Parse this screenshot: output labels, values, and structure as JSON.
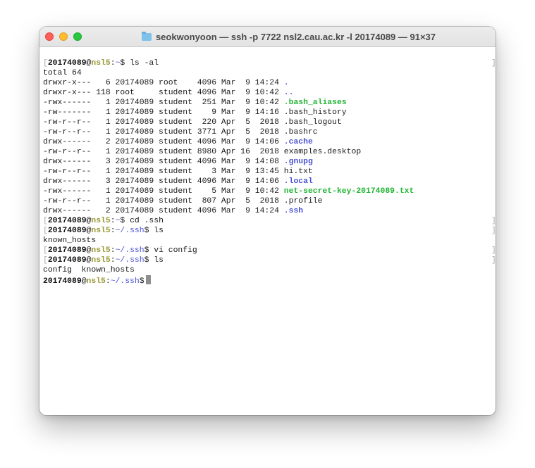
{
  "window": {
    "title": "seokwonyoon — ssh -p 7722 nsl2.cau.ac.kr -l 20174089 — 91×37",
    "icon": "folder-icon",
    "traffic_lights": {
      "close": "#fe5f57",
      "minimize": "#febc2e",
      "zoom": "#28c840"
    }
  },
  "colors": {
    "user": "#111111",
    "host": "#9a9a3a",
    "path": "#4d56d6",
    "directory": "#4a52d1",
    "executable": "#21b534"
  },
  "prompt": {
    "user": "20174089",
    "at": "@",
    "host": "nsl5",
    "colon": ":"
  },
  "terminal": {
    "cmd1": {
      "path": "~",
      "command": "ls -al"
    },
    "total": "total 64",
    "listing": [
      {
        "prefix": "drwxr-x---   6 20174089 root    4096 Mar  9 14:24 ",
        "name": ".",
        "type": "dir"
      },
      {
        "prefix": "drwxr-x--- 118 root     student 4096 Mar  9 10:42 ",
        "name": "..",
        "type": "dir"
      },
      {
        "prefix": "-rwx------   1 20174089 student  251 Mar  9 10:42 ",
        "name": ".bash_aliases",
        "type": "exe"
      },
      {
        "prefix": "-rw-------   1 20174089 student    9 Mar  9 14:16 ",
        "name": ".bash_history",
        "type": "file"
      },
      {
        "prefix": "-rw-r--r--   1 20174089 student  220 Apr  5  2018 ",
        "name": ".bash_logout",
        "type": "file"
      },
      {
        "prefix": "-rw-r--r--   1 20174089 student 3771 Apr  5  2018 ",
        "name": ".bashrc",
        "type": "file"
      },
      {
        "prefix": "drwx------   2 20174089 student 4096 Mar  9 14:06 ",
        "name": ".cache",
        "type": "dir"
      },
      {
        "prefix": "-rw-r--r--   1 20174089 student 8980 Apr 16  2018 ",
        "name": "examples.desktop",
        "type": "file"
      },
      {
        "prefix": "drwx------   3 20174089 student 4096 Mar  9 14:08 ",
        "name": ".gnupg",
        "type": "dir"
      },
      {
        "prefix": "-rw-r--r--   1 20174089 student    3 Mar  9 13:45 ",
        "name": "hi.txt",
        "type": "file"
      },
      {
        "prefix": "drwx------   3 20174089 student 4096 Mar  9 14:06 ",
        "name": ".local",
        "type": "dir"
      },
      {
        "prefix": "-rwx------   1 20174089 student    5 Mar  9 10:42 ",
        "name": "net-secret-key-20174089.txt",
        "type": "exe"
      },
      {
        "prefix": "-rw-r--r--   1 20174089 student  807 Apr  5  2018 ",
        "name": ".profile",
        "type": "file"
      },
      {
        "prefix": "drwx------   2 20174089 student 4096 Mar  9 14:24 ",
        "name": ".ssh",
        "type": "dir"
      }
    ],
    "cmd2": {
      "path": "~",
      "command": "cd .ssh"
    },
    "cmd3": {
      "path": "~/.ssh",
      "command": "ls"
    },
    "out3": "known_hosts",
    "cmd4": {
      "path": "~/.ssh",
      "command": "vi config"
    },
    "cmd5": {
      "path": "~/.ssh",
      "command": "ls"
    },
    "out5": "config  known_hosts",
    "cmd6": {
      "path": "~/.ssh",
      "command": ""
    }
  }
}
